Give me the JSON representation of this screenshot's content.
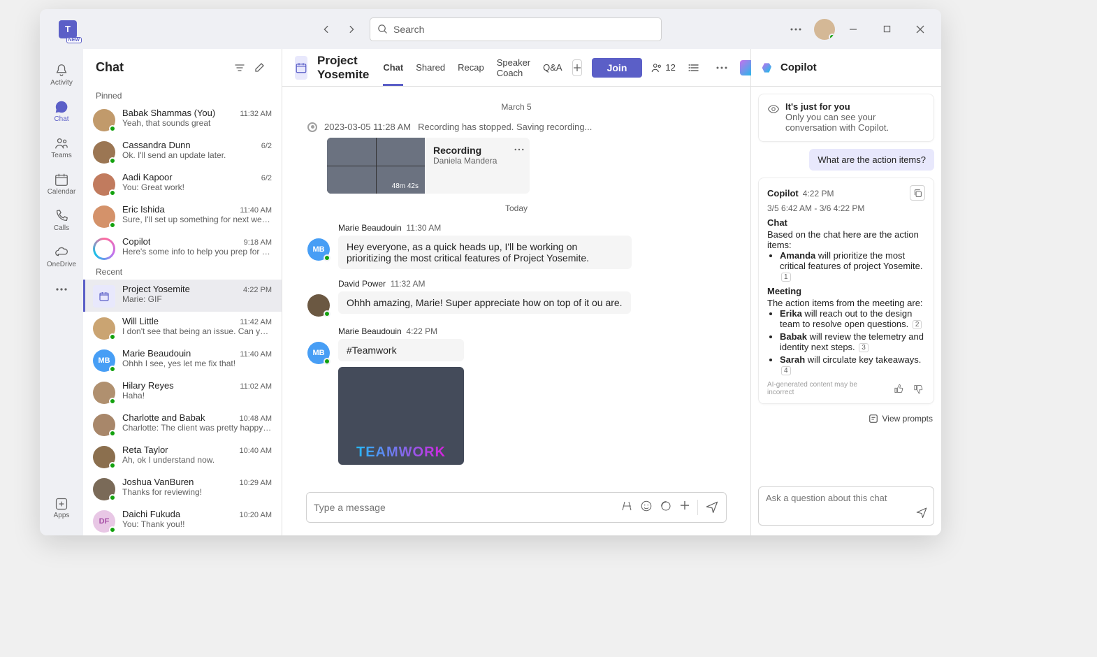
{
  "search": {
    "placeholder": "Search"
  },
  "rail": {
    "activity": "Activity",
    "chat": "Chat",
    "teams": "Teams",
    "calendar": "Calendar",
    "calls": "Calls",
    "onedrive": "OneDrive",
    "apps": "Apps"
  },
  "chatlist": {
    "title": "Chat",
    "sections": {
      "pinned": "Pinned",
      "recent": "Recent"
    },
    "pinned": [
      {
        "name": "Babak Shammas (You)",
        "preview": "Yeah, that sounds great",
        "time": "11:32 AM",
        "avatarClass": "av-bshammas",
        "initials": ""
      },
      {
        "name": "Cassandra Dunn",
        "preview": "Ok. I'll send an update later.",
        "time": "6/2",
        "avatarClass": "av-cdunn",
        "initials": ""
      },
      {
        "name": "Aadi Kapoor",
        "preview": "You: Great work!",
        "time": "6/2",
        "avatarClass": "av-akapoor",
        "initials": ""
      },
      {
        "name": "Eric Ishida",
        "preview": "Sure, I'll set up something for next week t…",
        "time": "11:40 AM",
        "avatarClass": "av-eishida",
        "initials": ""
      },
      {
        "name": "Copilot",
        "preview": "Here's some info to help you prep for your…",
        "time": "9:18 AM",
        "avatarClass": "copilot-avatar",
        "initials": ""
      }
    ],
    "recent": [
      {
        "name": "Project Yosemite",
        "preview": "Marie: GIF",
        "time": "4:22 PM",
        "avatarClass": "av-proj",
        "selected": true,
        "initials": ""
      },
      {
        "name": "Will Little",
        "preview": "I don't see that being an issue. Can you ta…",
        "time": "11:42 AM",
        "avatarClass": "av-wlittle",
        "initials": ""
      },
      {
        "name": "Marie Beaudouin",
        "preview": "Ohhh I see, yes let me fix that!",
        "time": "11:40 AM",
        "avatarClass": "av-mbeau",
        "initials": "MB"
      },
      {
        "name": "Hilary Reyes",
        "preview": "Haha!",
        "time": "11:02 AM",
        "avatarClass": "av-hreyes",
        "initials": ""
      },
      {
        "name": "Charlotte and Babak",
        "preview": "Charlotte: The client was pretty happy with…",
        "time": "10:48 AM",
        "avatarClass": "av-cbabak",
        "initials": ""
      },
      {
        "name": "Reta Taylor",
        "preview": "Ah, ok I understand now.",
        "time": "10:40 AM",
        "avatarClass": "av-rtaylor",
        "initials": ""
      },
      {
        "name": "Joshua VanBuren",
        "preview": "Thanks for reviewing!",
        "time": "10:29 AM",
        "avatarClass": "av-jvb",
        "initials": ""
      },
      {
        "name": "Daichi Fukuda",
        "preview": "You: Thank you!!",
        "time": "10:20 AM",
        "avatarClass": "av-dfukuda",
        "initials": "DF"
      }
    ]
  },
  "chat": {
    "title": "Project Yosemite",
    "tabs": {
      "chat": "Chat",
      "shared": "Shared",
      "recap": "Recap",
      "coach": "Speaker Coach",
      "qa": "Q&A"
    },
    "join": "Join",
    "participants": "12",
    "dateSep": "March 5",
    "todaySep": "Today",
    "recLine": {
      "ts": "2023-03-05 11:28 AM",
      "text": "Recording has stopped. Saving recording..."
    },
    "recCard": {
      "title": "Recording",
      "subtitle": "Daniela Mandera",
      "duration": "48m 42s"
    },
    "m1": {
      "author": "Marie Beaudouin",
      "time": "11:30 AM",
      "text": "Hey everyone, as a quick heads up, I'll be working on prioritizing the most critical features of Project Yosemite."
    },
    "m2": {
      "author": "David Power",
      "time": "11:32 AM",
      "text": "Ohhh amazing, Marie! Super appreciate how on top of it ou are."
    },
    "m3": {
      "author": "Marie Beaudouin",
      "time": "4:22 PM",
      "text": "#Teamwork",
      "gif": "TEAMWORK"
    },
    "composerPlaceholder": "Type a message"
  },
  "copilot": {
    "title": "Copilot",
    "privacy": {
      "title": "It's just for you",
      "body": "Only you can see your conversation with Copilot."
    },
    "userQ": "What are the action items?",
    "response": {
      "author": "Copilot",
      "time": "4:22 PM",
      "range": "3/5 6:42 AM - 3/6 4:22 PM",
      "chatHeading": "Chat",
      "chatIntro": "Based on the chat here are the action items:",
      "chatItem1_name": "Amanda",
      "chatItem1_rest": " will prioritize the most critical features of project Yosemite.",
      "chatItem1_ref": "1",
      "meetHeading": "Meeting",
      "meetIntro": "The action items from the meeting are:",
      "meetItem1_name": "Erika",
      "meetItem1_rest": " will reach out to the design team to resolve open questions.",
      "meetItem1_ref": "2",
      "meetItem2_name": "Babak",
      "meetItem2_rest": " will review the telemetry and identity next steps.",
      "meetItem2_ref": "3",
      "meetItem3_name": "Sarah",
      "meetItem3_rest": " will circulate key takeaways.",
      "meetItem3_ref": "4",
      "disclaimer": "AI-generated content may be incorrect"
    },
    "viewPrompts": "View prompts",
    "inputPlaceholder": "Ask a question about this chat"
  }
}
